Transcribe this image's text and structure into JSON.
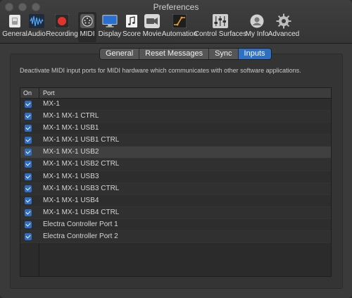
{
  "window": {
    "title": "Preferences"
  },
  "toolbar": {
    "items": [
      {
        "label": "General",
        "icon": "general-switch-icon"
      },
      {
        "label": "Audio",
        "icon": "audio-waveform-icon"
      },
      {
        "label": "Recording",
        "icon": "record-icon"
      },
      {
        "label": "MIDI",
        "icon": "midi-connector-icon",
        "selected": true
      },
      {
        "label": "Display",
        "icon": "display-monitor-icon"
      },
      {
        "label": "Score",
        "icon": "score-notes-icon"
      },
      {
        "label": "Movie",
        "icon": "movie-camera-icon"
      },
      {
        "label": "Automation",
        "icon": "automation-icon"
      },
      {
        "label": "Control Surfaces",
        "icon": "control-surface-icon"
      },
      {
        "label": "My Info",
        "icon": "person-icon"
      },
      {
        "label": "Advanced",
        "icon": "gear-icon"
      }
    ]
  },
  "tabs": {
    "items": [
      "General",
      "Reset Messages",
      "Sync",
      "Inputs"
    ],
    "active": "Inputs"
  },
  "inputs": {
    "description": "Deactivate MIDI input ports for MIDI hardware which communicates with other software applications.",
    "table": {
      "columns": {
        "on": "On",
        "port": "Port"
      },
      "rows": [
        {
          "port": "MX-1",
          "on": true
        },
        {
          "port": "MX-1 MX-1 CTRL",
          "on": true
        },
        {
          "port": "MX-1 MX-1 USB1",
          "on": true
        },
        {
          "port": "MX-1 MX-1 USB1 CTRL",
          "on": true
        },
        {
          "port": "MX-1 MX-1 USB2",
          "on": true,
          "selected": true
        },
        {
          "port": "MX-1 MX-1 USB2 CTRL",
          "on": true
        },
        {
          "port": "MX-1 MX-1 USB3",
          "on": true
        },
        {
          "port": "MX-1 MX-1 USB3 CTRL",
          "on": true
        },
        {
          "port": "MX-1 MX-1 USB4",
          "on": true
        },
        {
          "port": "MX-1 MX-1 USB4 CTRL",
          "on": true
        },
        {
          "port": "Electra Controller Port 1",
          "on": true
        },
        {
          "port": "Electra Controller Port 2",
          "on": true
        }
      ]
    }
  },
  "colors": {
    "accent": "#2f6fc4",
    "window_bg": "#3a3a3a",
    "record_red": "#e0342c"
  }
}
